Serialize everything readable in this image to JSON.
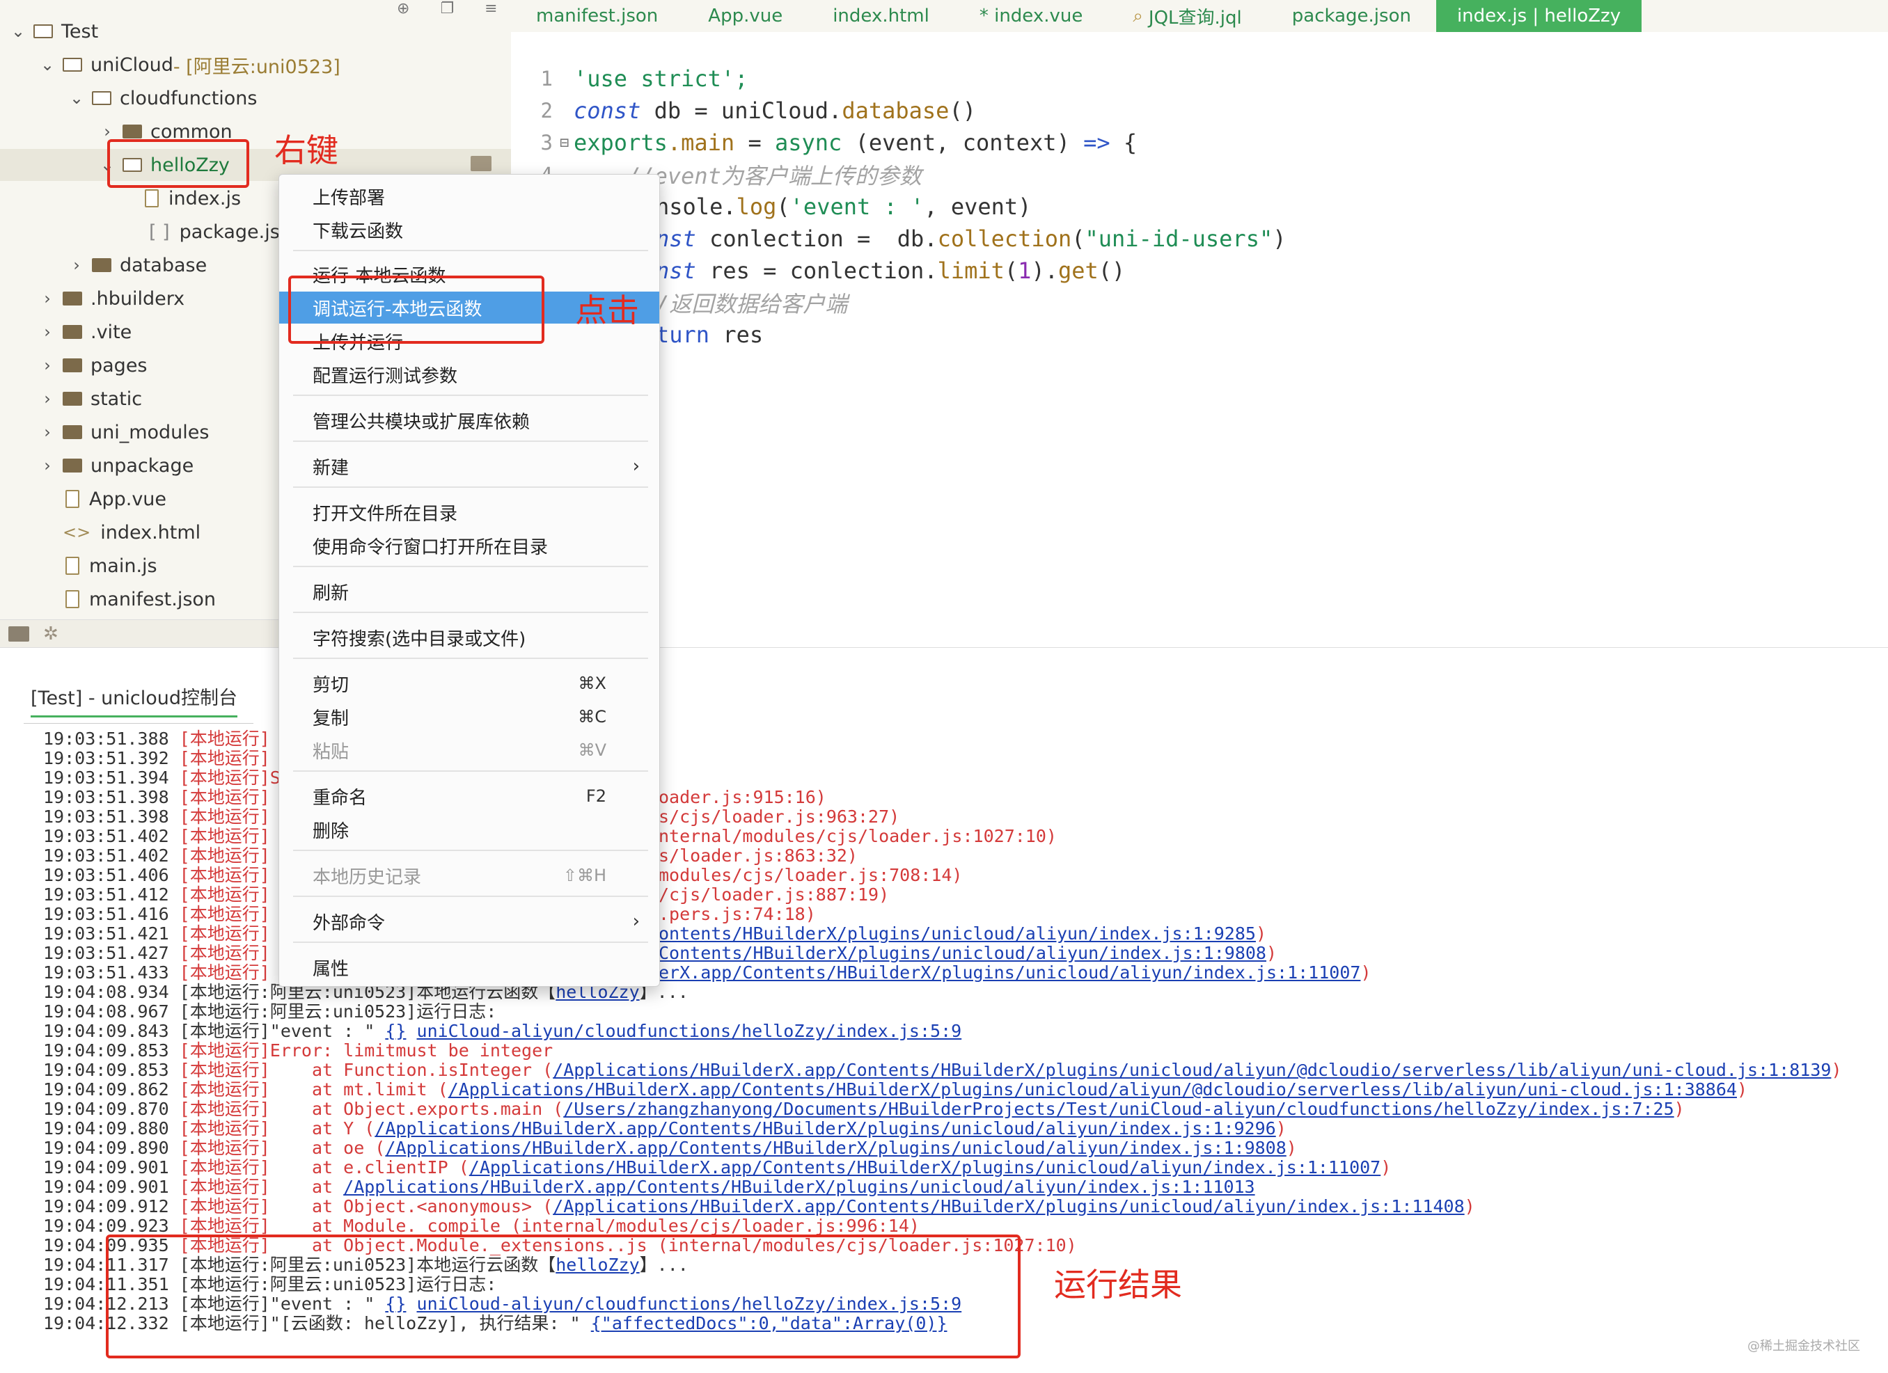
{
  "tabs": [
    {
      "label": "manifest.json"
    },
    {
      "label": "App.vue"
    },
    {
      "label": "index.html"
    },
    {
      "label": "* index.vue"
    },
    {
      "label": "JQL查询.jql",
      "icon": "jql-search-icon"
    },
    {
      "label": "package.json"
    },
    {
      "label": "index.js | helloZzy",
      "active": true
    }
  ],
  "tree": {
    "project": "Test",
    "unicloud": "uniCloud",
    "unicloud_tag": " - [阿里云:uni0523]",
    "cloudfunctions": "cloudfunctions",
    "common": "common",
    "hellozzy": "helloZzy",
    "index_js": "index.js",
    "package_json": "package.jsc",
    "database": "database",
    "hbuilderx": ".hbuilderx",
    "vite": ".vite",
    "pages": "pages",
    "static": "static",
    "uni_modules": "uni_modules",
    "unpackage": "unpackage",
    "app_vue": "App.vue",
    "index_html": "index.html",
    "main_js": "main.js",
    "manifest_json": "manifest.json"
  },
  "code": {
    "l1": "'use strict';",
    "l2_kw": "const",
    "l2_rest": " db = uniCloud.",
    "l2_fn": "database",
    "l2_end": "()",
    "l3_a": "exports",
    "l3_b": ".main",
    "l3_c": " = ",
    "l3_d": "async",
    "l3_e": " (event, context) ",
    "l3_f": "=>",
    "l3_g": " {",
    "l4": "    //event为客户端上传的参数",
    "l5_a": "nsole.",
    "l5_b": "log",
    "l5_c": "(",
    "l5_d": "'event : '",
    "l5_e": ", event)",
    "l6_a": "nst",
    "l6_b": " conlection =  db.",
    "l6_c": "collection",
    "l6_d": "(",
    "l6_e": "\"uni-id-users\"",
    "l6_f": ")",
    "l7_a": "nst",
    "l7_b": " res = conlection.",
    "l7_c": "limit",
    "l7_d": "(",
    "l7_e": "1",
    "l7_f": ").",
    "l7_g": "get",
    "l7_h": "()",
    "l8": "/返回数据给客户端",
    "l9_a": "turn",
    "l9_b": " res",
    "line_numbers": [
      "1",
      "2",
      "3",
      "4"
    ],
    "fold_mark": "⊟"
  },
  "menu": {
    "upload_deploy": "上传部署",
    "download_fn": "下载云函数",
    "run_local": "运行-本地云函数",
    "debug_run_local": "调试运行-本地云函数",
    "upload_run": "上传并运行",
    "config_params": "配置运行测试参数",
    "manage_modules": "管理公共模块或扩展库依赖",
    "new": "新建",
    "open_dir": "打开文件所在目录",
    "open_cmd_dir": "使用命令行窗口打开所在目录",
    "refresh": "刷新",
    "search": "字符搜索(选中目录或文件)",
    "cut": "剪切",
    "cut_sc": "⌘X",
    "copy": "复制",
    "copy_sc": "⌘C",
    "paste": "粘贴",
    "paste_sc": "⌘V",
    "rename": "重命名",
    "rename_sc": "F2",
    "delete": "删除",
    "history": "本地历史记录",
    "history_sc": "⇧⌘H",
    "external": "外部命令",
    "properties": "属性",
    "arrow": "›"
  },
  "console": {
    "tab_title": "[Test] - unicloud控制台",
    "tag_local": "[本地运行]",
    "logs_top": [
      {
        "time": "19:03:51.388 ",
        "tail": ""
      },
      {
        "time": "19:03:51.392 ",
        "tail": ""
      },
      {
        "time": "19:03:51.394 ",
        "tail": "Sy"
      },
      {
        "time": "19:03:51.398 ",
        "tail": ""
      },
      {
        "time": "19:03:51.398 ",
        "tail": ""
      },
      {
        "time": "19:03:51.402 ",
        "tail": ""
      },
      {
        "time": "19:03:51.402 ",
        "tail": ""
      },
      {
        "time": "19:03:51.406 ",
        "tail": ""
      },
      {
        "time": "19:03:51.412 ",
        "tail": ""
      },
      {
        "time": "19:03:51.416 ",
        "tail": ""
      },
      {
        "time": "19:03:51.421 ",
        "tail": ""
      },
      {
        "time": "19:03:51.427 ",
        "tail": ""
      },
      {
        "time": "19:03:51.433 ",
        "tail": ""
      }
    ],
    "right_frags": [
      {
        "text": "oader.js:915:16)",
        "link": false
      },
      {
        "text": "s/cjs/loader.js:963:27)",
        "link": false
      },
      {
        "text": "nternal/modules/cjs/loader.js:1027:10)",
        "link": false
      },
      {
        "text": "s/loader.js:863:32)",
        "link": false
      },
      {
        "text": "modules/cjs/loader.js:708:14)",
        "link": false
      },
      {
        "text": "/cjs/loader.js:887:19)",
        "link": false
      },
      {
        "text": ".pers.js:74:18)",
        "link": false
      },
      {
        "text": "ontents/HBuilderX/plugins/unicloud/aliyun/index.js:1:9285",
        "link": true
      },
      {
        "text": "Contents/HBuilderX/plugins/unicloud/aliyun/index.js:1:9808",
        "link": true
      },
      {
        "text": "erX.app/Contents/HBuilderX/plugins/unicloud/aliyun/index.js:1:11007",
        "link": true
      }
    ],
    "l_run1_a": "19:04:08.934 [本地运行:阿里云:uni0523]本地运行云函数【",
    "l_run1_link": "helloZzy",
    "l_run1_b": "】...",
    "l_log1": "19:04:08.967 [本地运行:阿里云:uni0523]运行日志:",
    "l_ev1_a": "19:04:09.843 [本地运行]\"event : \" ",
    "l_ev1_b": "{}",
    "l_ev1_c": " ",
    "l_ev1_link": "uniCloud-aliyun/cloudfunctions/helloZzy/index.js:5:9",
    "l_err_time": "19:04:09.853 ",
    "l_err_text": "Error: limitmust be integer",
    "stack": [
      {
        "time": "19:04:09.853 ",
        "at": "    at Function.isInteger (",
        "link": "/Applications/HBuilderX.app/Contents/HBuilderX/plugins/unicloud/aliyun/@dcloudio/serverless/lib/aliyun/uni-cloud.js:1:8139",
        "end": ")"
      },
      {
        "time": "19:04:09.862 ",
        "at": "    at mt.limit (",
        "link": "/Applications/HBuilderX.app/Contents/HBuilderX/plugins/unicloud/aliyun/@dcloudio/serverless/lib/aliyun/uni-cloud.js:1:38864",
        "end": ")"
      },
      {
        "time": "19:04:09.870 ",
        "at": "    at Object.exports.main (",
        "link": "/Users/zhangzhanyong/Documents/HBuilderProjects/Test/uniCloud-aliyun/cloudfunctions/helloZzy/index.js:7:25",
        "end": ")"
      },
      {
        "time": "19:04:09.880 ",
        "at": "    at Y (",
        "link": "/Applications/HBuilderX.app/Contents/HBuilderX/plugins/unicloud/aliyun/index.js:1:9296",
        "end": ")"
      },
      {
        "time": "19:04:09.890 ",
        "at": "    at oe (",
        "link": "/Applications/HBuilderX.app/Contents/HBuilderX/plugins/unicloud/aliyun/index.js:1:9808",
        "end": ")"
      },
      {
        "time": "19:04:09.901 ",
        "at": "    at e.clientIP (",
        "link": "/Applications/HBuilderX.app/Contents/HBuilderX/plugins/unicloud/aliyun/index.js:1:11007",
        "end": ")"
      },
      {
        "time": "19:04:09.901 ",
        "at": "    at ",
        "link": "/Applications/HBuilderX.app/Contents/HBuilderX/plugins/unicloud/aliyun/index.js:1:11013",
        "end": ""
      },
      {
        "time": "19:04:09.912 ",
        "at": "    at Object.<anonymous> (",
        "link": "/Applications/HBuilderX.app/Contents/HBuilderX/plugins/unicloud/aliyun/index.js:1:11408",
        "end": ")"
      },
      {
        "time": "19:04:09.923 ",
        "at": "    at Module._compile (internal/modules/cjs/loader.js:996:14)",
        "link": "",
        "end": ""
      },
      {
        "time": "19:04:09.935 ",
        "at": "    at Object.Module._extensions..js (internal/modules/cjs/loader.js:1027:10)",
        "link": "",
        "end": ""
      }
    ],
    "l_run2_a": "19:04:11.317 [本地运行:阿里云:uni0523]本地运行云函数【",
    "l_run2_link": "helloZzy",
    "l_run2_b": "】...",
    "l_log2": "19:04:11.351 [本地运行:阿里云:uni0523]运行日志:",
    "l_ev2_a": "19:04:12.213 [本地运行]\"event : \" ",
    "l_ev2_b": "{}",
    "l_ev2_c": " ",
    "l_ev2_link": "uniCloud-aliyun/cloudfunctions/helloZzy/index.js:5:9",
    "l_res_a": "19:04:12.332 [本地运行]\"[云函数: helloZzy], 执行结果: \" ",
    "l_res_link": "{\"affectedDocs\":0,\"data\":Array(0)}"
  },
  "annotations": {
    "right_click": "右键",
    "click": "点击",
    "run_result": "运行结果"
  },
  "colors": {
    "accent_green": "#46b15e",
    "annotation_red": "#e22b1f",
    "menu_highlight": "#4f9ee5",
    "log_red": "#d43a3a",
    "link_blue": "#1a3fb3"
  },
  "watermark": "@稀土掘金技术社区"
}
